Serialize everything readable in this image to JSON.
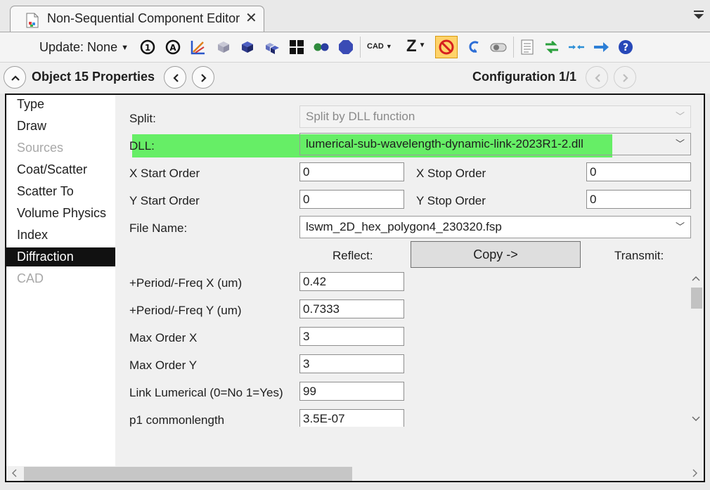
{
  "tab": {
    "title": "Non-Sequential Component Editor"
  },
  "toolbar": {
    "update_label": "Update: None",
    "cad_label": "CAD",
    "z_label": "Z"
  },
  "object_bar": {
    "object_label": "Object  15 Properties",
    "configuration_label": "Configuration 1/1"
  },
  "sidebar": {
    "items": [
      {
        "label": "Type"
      },
      {
        "label": "Draw"
      },
      {
        "label": "Sources"
      },
      {
        "label": "Coat/Scatter"
      },
      {
        "label": "Scatter To"
      },
      {
        "label": "Volume Physics"
      },
      {
        "label": "Index"
      },
      {
        "label": "Diffraction"
      },
      {
        "label": "CAD"
      }
    ],
    "selected": "Diffraction"
  },
  "form": {
    "split_label": "Split:",
    "split_value": "Split by DLL function",
    "dll_label": "DLL:",
    "dll_value": "lumerical-sub-wavelength-dynamic-link-2023R1-2.dll",
    "x_start_label": "X Start Order",
    "x_start_value": "0",
    "x_stop_label": "X Stop Order",
    "x_stop_value": "0",
    "y_start_label": "Y Start Order",
    "y_start_value": "0",
    "y_stop_label": "Y Stop Order",
    "y_stop_value": "0",
    "file_name_label": "File Name:",
    "file_name_value": "lswm_2D_hex_polygon4_230320.fsp",
    "reflect_label": "Reflect:",
    "copy_label": "Copy ->",
    "transmit_label": "Transmit:",
    "params": [
      {
        "label": "+Period/-Freq X (um)",
        "value": "0.42"
      },
      {
        "label": "+Period/-Freq Y (um)",
        "value": "0.7333"
      },
      {
        "label": "Max Order X",
        "value": "3"
      },
      {
        "label": "Max Order Y",
        "value": "3"
      },
      {
        "label": "Link Lumerical (0=No 1=Yes)",
        "value": "99"
      },
      {
        "label": "p1 commonlength",
        "value": "3.5E-07"
      }
    ]
  },
  "colors": {
    "highlight": "#66ee66",
    "selected_bg": "#111111",
    "active_tool": "#ffd36a"
  }
}
